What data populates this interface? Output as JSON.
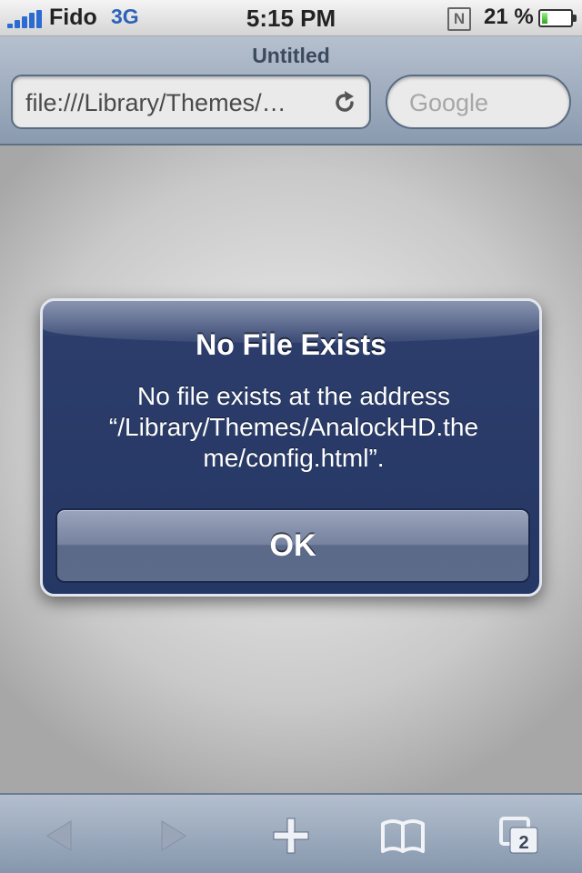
{
  "status_bar": {
    "carrier": "Fido",
    "network": "3G",
    "time": "5:15 PM",
    "battery_percent": "21 %",
    "battery_level": 0.21,
    "icons": [
      "signal-bars-icon",
      "notification-n-icon",
      "battery-icon"
    ]
  },
  "browser": {
    "page_title": "Untitled",
    "url": "file:///Library/Themes/AnalockHD.theme/config.html",
    "url_display": "file:///Library/Themes/…",
    "search_placeholder": "Google"
  },
  "alert": {
    "title": "No File Exists",
    "message_lines": [
      "No file exists at the address",
      "“/Library/Themes/AnalockHD.the",
      "me/config.html”."
    ],
    "ok_label": "OK"
  },
  "toolbar": {
    "tabs_count": "2",
    "icons": [
      "back-arrow-icon",
      "forward-arrow-icon",
      "add-icon",
      "bookmarks-icon",
      "pages-icon"
    ]
  },
  "colors": {
    "alert_background": "#253764",
    "network_label": "#2d62b8",
    "toolbar_background": "#8697ad"
  }
}
